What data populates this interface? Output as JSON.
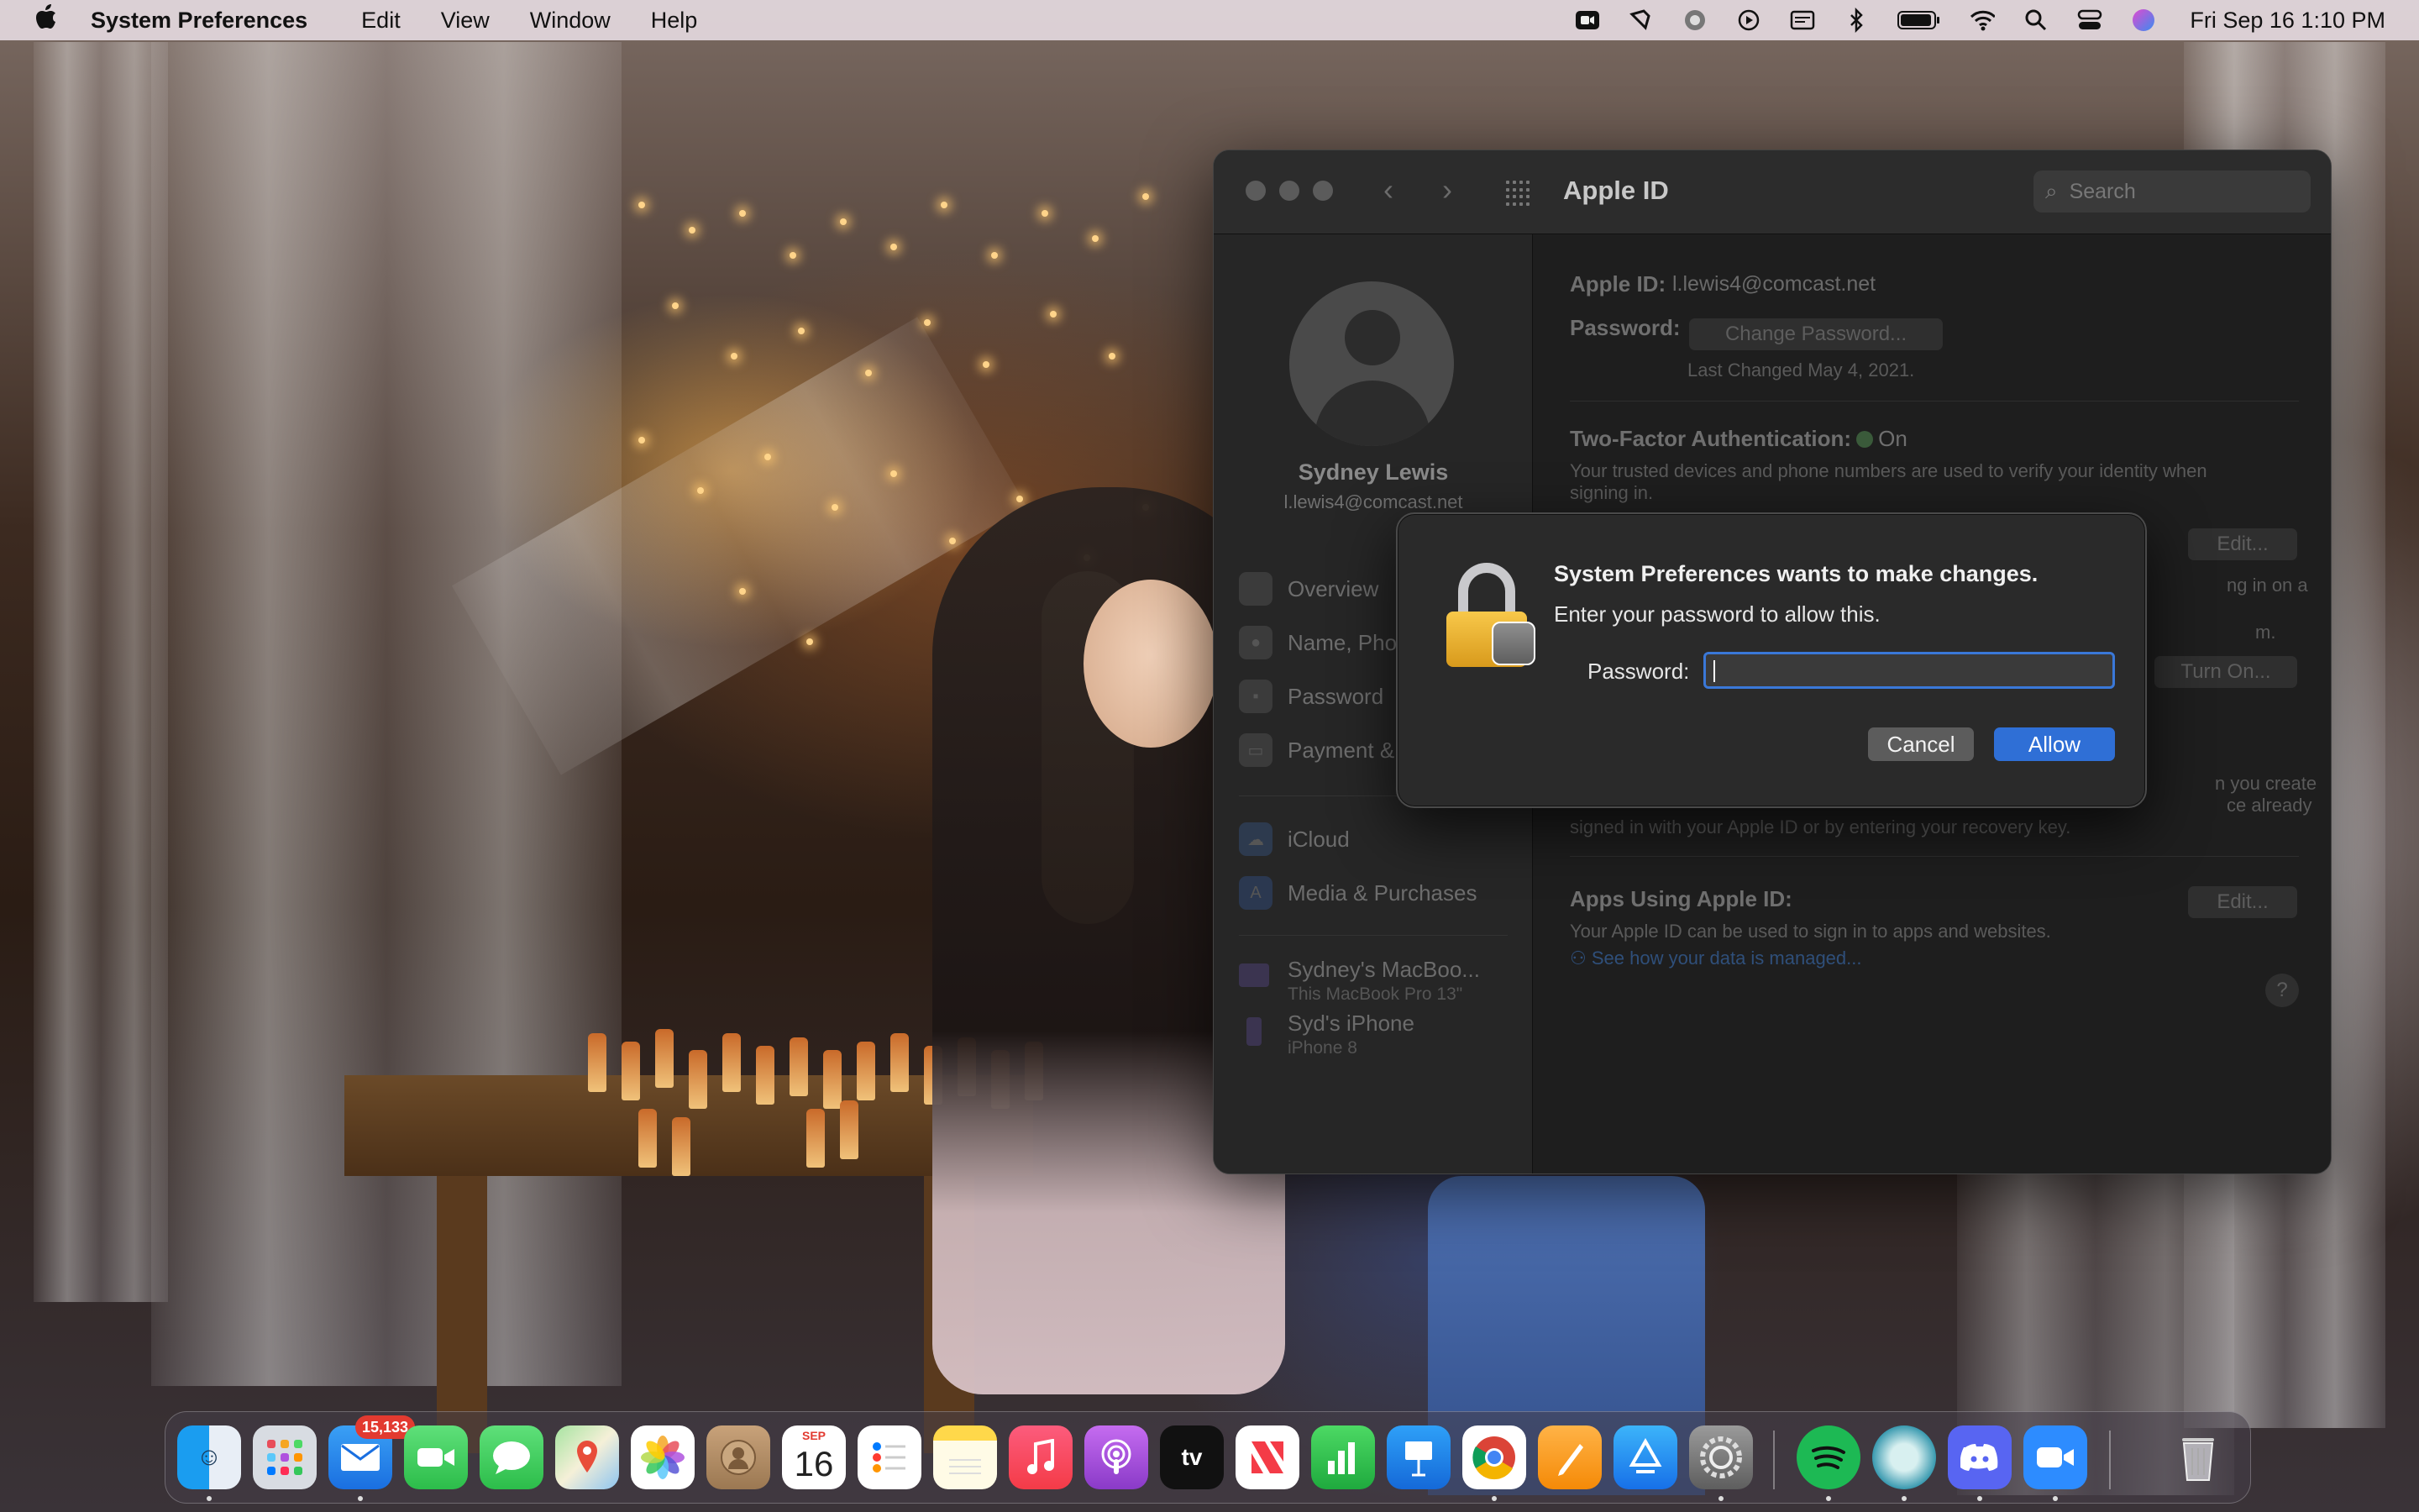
{
  "menubar": {
    "apple_icon": "apple-logo",
    "app_name": "System Preferences",
    "menus": [
      "Edit",
      "View",
      "Window",
      "Help"
    ],
    "status_icons": [
      "facetime-camera-icon",
      "screenshot-tool-icon",
      "creative-cloud-icon",
      "play-icon",
      "calendar-ctrl-icon",
      "bluetooth-icon",
      "battery-icon",
      "wifi-icon",
      "spotlight-search-icon",
      "control-center-icon",
      "siri-icon"
    ],
    "clock": "Fri Sep 16  1:10 PM"
  },
  "window": {
    "title": "Apple ID",
    "search_placeholder": "Search",
    "sidebar": {
      "user_name": "Sydney Lewis",
      "user_email": "l.lewis4@comcast.net",
      "items": [
        {
          "label": "Overview",
          "icon": "apple-icon"
        },
        {
          "label": "Name, Pho",
          "icon": "person-icon"
        },
        {
          "label": "Password",
          "icon": "lock-icon"
        },
        {
          "label": "Payment &",
          "icon": "card-icon"
        },
        {
          "label": "iCloud",
          "icon": "icloud-icon"
        },
        {
          "label": "Media & Purchases",
          "icon": "app-store-icon"
        }
      ],
      "devices": [
        {
          "name": "Sydney's MacBoo...",
          "sub": "This MacBook Pro 13\""
        },
        {
          "name": "Syd's iPhone",
          "sub": "iPhone 8"
        }
      ]
    },
    "main": {
      "apple_id_label": "Apple ID:",
      "apple_id_value": "l.lewis4@comcast.net",
      "password_label": "Password:",
      "change_password_button": "Change Password...",
      "last_changed": "Last Changed May 4, 2021.",
      "two_factor_label": "Two-Factor Authentication:",
      "two_factor_value": "On",
      "two_factor_desc_1": "Your trusted devices and phone numbers are used to verify your identity when",
      "two_factor_desc_2": "signing in.",
      "edit_button_1": "Edit...",
      "partial_text_1": "ng in on a",
      "partial_text_2": "m.",
      "turn_on_button": "Turn On...",
      "recovery_partial_1": "n you create",
      "recovery_partial_2": "ce already",
      "recovery_partial_3": "signed in with your Apple ID or by entering your recovery key.",
      "apps_label": "Apps Using Apple ID:",
      "edit_button_2": "Edit...",
      "apps_desc": "Your Apple ID can be used to sign in to apps and websites.",
      "data_link": "See how your data is managed...",
      "help": "?"
    }
  },
  "dialog": {
    "title": "System Preferences wants to make changes.",
    "message": "Enter your password to allow this.",
    "password_label": "Password:",
    "password_value": "",
    "cancel_label": "Cancel",
    "allow_label": "Allow",
    "accent": "#2f6fd6"
  },
  "dock": {
    "mail_badge": "15,133",
    "calendar_month": "SEP",
    "calendar_day": "16",
    "apps": [
      "finder",
      "launchpad",
      "mail",
      "facetime",
      "messages",
      "maps",
      "photos",
      "contacts",
      "calendar",
      "reminders",
      "notes",
      "music",
      "podcasts",
      "apple-tv",
      "news",
      "numbers",
      "keynote",
      "chrome",
      "pages",
      "app-store",
      "system-preferences",
      "spotify",
      "webcatalog",
      "discord",
      "zoom",
      "trash"
    ],
    "tv_label": "tv"
  }
}
